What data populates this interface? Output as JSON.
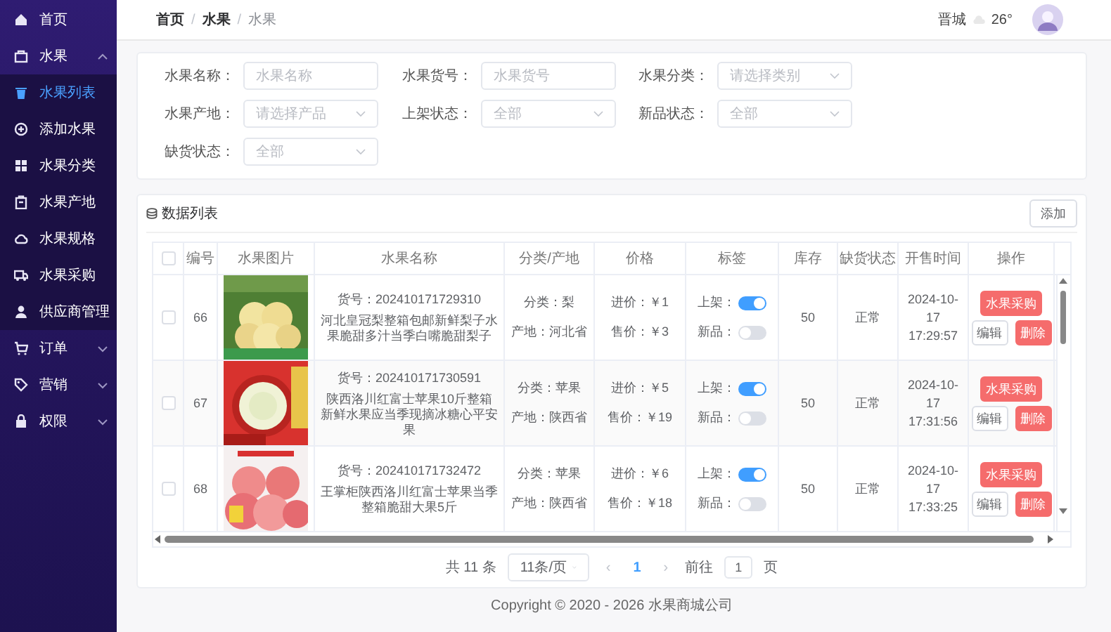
{
  "sidebar": {
    "items": [
      {
        "label": "首页",
        "kind": "link",
        "selected": false
      },
      {
        "label": "水果",
        "kind": "group",
        "selected": false,
        "expanded": true,
        "children": [
          {
            "label": "水果列表",
            "selected": true
          },
          {
            "label": "添加水果",
            "selected": false
          },
          {
            "label": "水果分类",
            "selected": false
          },
          {
            "label": "水果产地",
            "selected": false
          },
          {
            "label": "水果规格",
            "selected": false
          },
          {
            "label": "水果采购",
            "selected": false
          },
          {
            "label": "供应商管理",
            "selected": false
          }
        ]
      },
      {
        "label": "订单",
        "kind": "group",
        "selected": false,
        "expanded": false
      },
      {
        "label": "营销",
        "kind": "group",
        "selected": false,
        "expanded": false
      },
      {
        "label": "权限",
        "kind": "group",
        "selected": false,
        "expanded": false
      }
    ]
  },
  "header": {
    "breadcrumb": [
      {
        "label": "首页",
        "current": false
      },
      {
        "label": "水果",
        "current": false
      },
      {
        "label": "水果",
        "current": true
      }
    ],
    "separator": "/",
    "city": "晋城",
    "temperature": "26°"
  },
  "filters": [
    {
      "label": "水果名称：",
      "kind": "input",
      "placeholder": "水果名称"
    },
    {
      "label": "水果货号：",
      "kind": "input",
      "placeholder": "水果货号"
    },
    {
      "label": "水果分类：",
      "kind": "select",
      "placeholder": "请选择类别"
    },
    {
      "label": "水果产地：",
      "kind": "select",
      "placeholder": "请选择产品"
    },
    {
      "label": "上架状态：",
      "kind": "select",
      "placeholder": "全部"
    },
    {
      "label": "新品状态：",
      "kind": "select",
      "placeholder": "全部"
    },
    {
      "label": "缺货状态：",
      "kind": "select",
      "placeholder": "全部"
    }
  ],
  "list": {
    "title": "数据列表",
    "add_button": "添加"
  },
  "table": {
    "header_checked": false,
    "columns": [
      "编号",
      "水果图片",
      "水果名称",
      "分类/产地",
      "价格",
      "标签",
      "库存",
      "缺货状态",
      "开售时间",
      "操作"
    ],
    "rows": [
      {
        "checked": false,
        "id": "66",
        "code": "货号：202410171729310",
        "name": "河北皇冠梨整箱包邮新鲜梨子水果脆甜多汁当季白嘴脆甜梨子",
        "category": "分类：梨",
        "origin": "产地：河北省",
        "cost": "进价：￥1",
        "price": "售价：￥3",
        "shelf_label": "上架：",
        "on_shelf": true,
        "new_label": "新品：",
        "is_new": false,
        "stock": "50",
        "status": "正常",
        "time": "2024-10-17 17:29:57",
        "actions": [
          "水果采购",
          "编辑",
          "删除"
        ]
      },
      {
        "checked": false,
        "id": "67",
        "code": "货号：202410171730591",
        "name": "陕西洛川红富士苹果10斤整箱新鲜水果应当季现摘冰糖心平安果",
        "category": "分类：苹果",
        "origin": "产地：陕西省",
        "cost": "进价：￥5",
        "price": "售价：￥19",
        "shelf_label": "上架：",
        "on_shelf": true,
        "new_label": "新品：",
        "is_new": false,
        "stock": "50",
        "status": "正常",
        "time": "2024-10-17 17:31:56",
        "actions": [
          "水果采购",
          "编辑",
          "删除"
        ]
      },
      {
        "checked": false,
        "id": "68",
        "code": "货号：202410171732472",
        "name": "王掌柜陕西洛川红富士苹果当季整箱脆甜大果5斤",
        "category": "分类：苹果",
        "origin": "产地：陕西省",
        "cost": "进价：￥6",
        "price": "售价：￥18",
        "shelf_label": "上架：",
        "on_shelf": true,
        "new_label": "新品：",
        "is_new": false,
        "stock": "50",
        "status": "正常",
        "time": "2024-10-17 17:33:25",
        "actions": [
          "水果采购",
          "编辑",
          "删除"
        ]
      }
    ]
  },
  "pagination": {
    "total": "共 11 条",
    "page_size": "11条/页",
    "prev": "‹",
    "pages": [
      {
        "label": "1",
        "selected": true
      }
    ],
    "next": "›",
    "goto_label": "前往",
    "goto_value": "1",
    "goto_suffix": "页"
  },
  "footer": "Copyright © 2020 - 2026  水果商城公司"
}
